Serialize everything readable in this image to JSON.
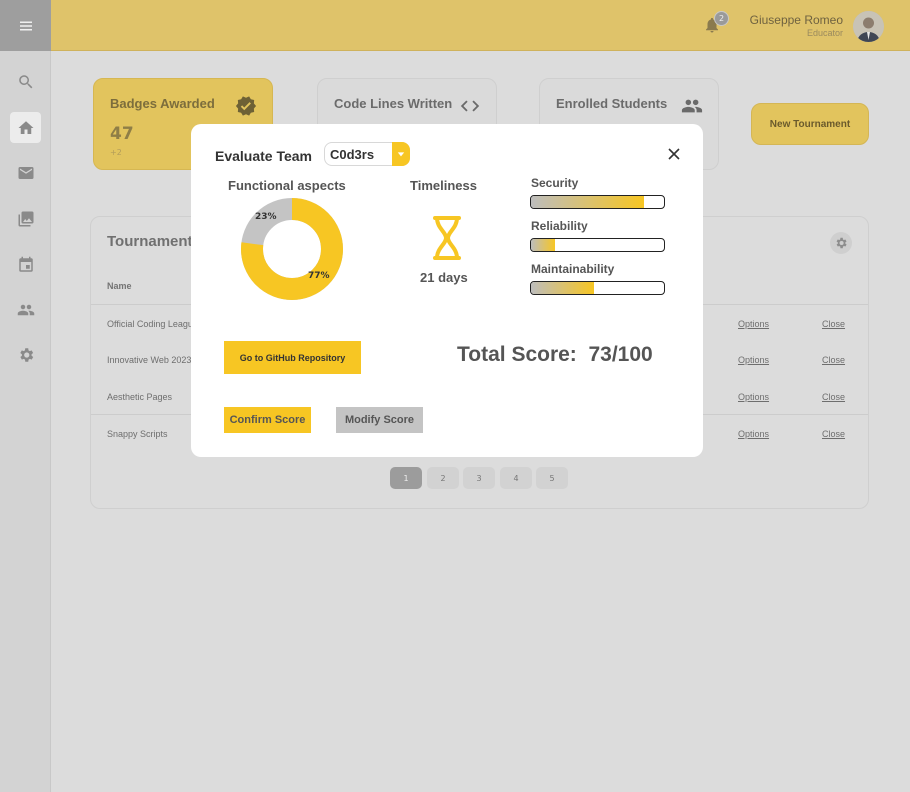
{
  "sidebar": {
    "icons": [
      "menu-icon",
      "search-icon",
      "home-icon",
      "mail-icon",
      "gallery-icon",
      "calendar-icon",
      "people-icon",
      "gear-icon"
    ],
    "active": "home-icon"
  },
  "header": {
    "notifications_count": "2",
    "user_name": "Giuseppe Romeo",
    "user_role": "Educator",
    "accent_color": "#dfc36a"
  },
  "cards": [
    {
      "title": "Badges Awarded",
      "icon": "verified-badge-icon",
      "value": "47",
      "delta": "+2"
    },
    {
      "title": "Code Lines Written",
      "icon": "code-icon"
    },
    {
      "title": "Enrolled Students",
      "icon": "people-icon"
    }
  ],
  "new_tournament_label": "New Tournament",
  "table": {
    "title": "Tournaments",
    "col_name": "Name",
    "rows": [
      {
        "name": "Official Coding League",
        "options": "Options",
        "close": "Close"
      },
      {
        "name": "Innovative Web 2023",
        "options": "Options",
        "close": "Close"
      },
      {
        "name": "Aesthetic Pages",
        "options": "Options",
        "close": "Close"
      },
      {
        "name": "Snappy Scripts",
        "options": "Options",
        "close": "Close"
      }
    ],
    "pages": [
      "1",
      "2",
      "3",
      "4",
      "5"
    ],
    "current_page": "1"
  },
  "modal": {
    "title": "Evaluate Team",
    "team": "C0d3rs",
    "functional_title": "Functional aspects",
    "functional_pass_pct": 77,
    "functional_fail_pct": 23,
    "functional_pass_label": "77%",
    "functional_fail_label": "23%",
    "timeliness_title": "Timeliness",
    "timeliness_value": "21 days",
    "metrics": [
      {
        "label": "Security",
        "value": 0.85
      },
      {
        "label": "Reliability",
        "value": 0.18
      },
      {
        "label": "Maintainability",
        "value": 0.47
      }
    ],
    "github_button": "Go to GitHub Repository",
    "total_label": "Total Score:",
    "total_value": "73/100",
    "confirm_button": "Confirm Score",
    "modify_button": "Modify Score",
    "accent_color": "#f7c623"
  }
}
